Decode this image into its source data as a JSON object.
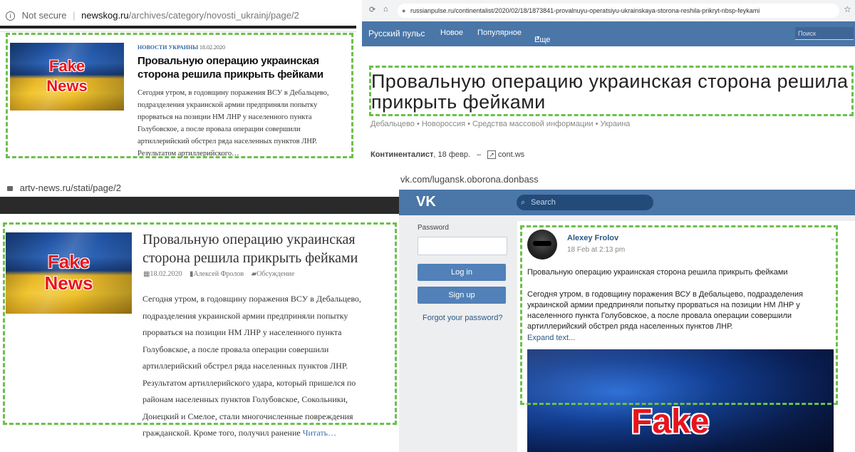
{
  "panel_newskog": {
    "address": {
      "security": "Not secure",
      "domain": "newskog.ru",
      "path": "/archives/category/novosti_ukrainj/page/2"
    },
    "thumb": {
      "line1": "Fake",
      "line2": "News"
    },
    "category": "НОВОСТИ УКРАИНЫ",
    "date": "18.02.2020",
    "title": "Провальную операцию украинская сторона решила прикрыть фейками",
    "excerpt": "Сегодня утром, в годовщину поражения ВСУ в Дебальцево, подразделения украинской армии предприняли попытку прорваться на позиции НМ ЛНР у населенного пункта Голубовское, а после провала операции совершили артиллерийский обстрел ряда населенных пунктов ЛНР. Результатом артиллерийского…"
  },
  "panel_russianpulse": {
    "url": "russianpulse.ru/continentalist/2020/02/18/1873841-provalnuyu-operatsiyu-ukrainskaya-storona-reshila-prikryt-nbsp-feykami",
    "nav": {
      "brand": "Русский пульс",
      "items": [
        "Новое",
        "Популярное",
        "Еще"
      ],
      "search_placeholder": "Поиск"
    },
    "title": "Провальную операцию украинская сторона решила прикрыть фейками",
    "tags": "Дебальцево • Новороссия • Средства массовой информации • Украина",
    "author": "Континенталист",
    "date": "18 февр.",
    "sep": "–",
    "source": "cont.ws"
  },
  "panel_artv": {
    "address": "artv-news.ru/stati/page/2",
    "thumb": {
      "line1": "Fake",
      "line2": "News"
    },
    "title": "Провальную операцию украинская сторона решила прикрыть фейками",
    "date": "18.02.2020",
    "author": "Алексей Фролов",
    "comments": "Обсуждение",
    "body": "Сегодня утром, в годовщину поражения ВСУ в Дебальцево, подразделения украинской армии предприняли попытку прорваться на позиции НМ ЛНР у населенного пункта Голубовское, а после провала операции совершили артиллерийский обстрел ряда населенных пунктов ЛНР. Результатом артиллерийского удара, который пришелся по районам населенных пунктов Голубовское, Сокольники, Донецкий и Смелое, стали многочисленные повреждения гражданской. Кроме того, получил ранение",
    "read_more": "Читать…"
  },
  "panel_vk": {
    "url": "vk.com/lugansk.oborona.donbass",
    "logo": "VK",
    "search_placeholder": "Search",
    "login": {
      "password_label": "Password",
      "login_button": "Log in",
      "signup_button": "Sign up",
      "forgot": "Forgot your password?"
    },
    "post": {
      "author": "Alexey Frolov",
      "time": "18 Feb at 2:13 pm",
      "title": "Провальную операцию украинская сторона решила прикрыть фейками",
      "text": "Сегодня утром, в годовщину поражения ВСУ в Дебальцево, подразделения украинской армии предприняли попытку прорваться на позиции НМ ЛНР у населенного пункта Голубовское, а после провала операции совершили артиллерийский обстрел ряда населенных пунктов ЛНР.",
      "expand": "Expand text...",
      "image_text": "Fake"
    }
  },
  "colors": {
    "highlight": "#6cc04a",
    "vk_blue": "#4a76a8",
    "fake_red": "#e8141c"
  }
}
